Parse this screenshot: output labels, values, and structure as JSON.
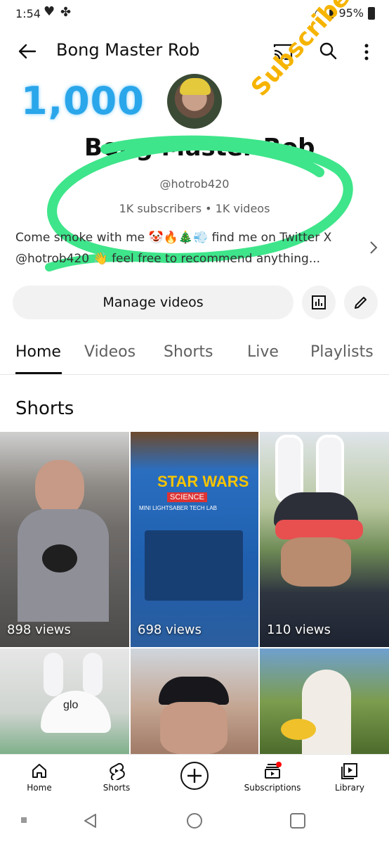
{
  "status_bar": {
    "time": "1:54",
    "battery": "95%"
  },
  "header": {
    "title": "Bong Master Rob"
  },
  "overlays": {
    "count": "1,000",
    "label": "Subscribers"
  },
  "channel": {
    "name": "Bong Master Rob",
    "handle": "@hotrob420",
    "stats": "1K subscribers • 1K videos",
    "description": "Come smoke with me 🤡🔥🎄💨 find me on Twitter X @hotrob420 👋 feel free to recommend anything..."
  },
  "actions": {
    "manage_label": "Manage videos"
  },
  "tabs": [
    "Home",
    "Videos",
    "Shorts",
    "Live",
    "Playlists"
  ],
  "section": {
    "title": "Shorts"
  },
  "shorts": [
    {
      "views": "898 views"
    },
    {
      "views": "698 views"
    },
    {
      "views": "110 views"
    },
    {
      "views": ""
    },
    {
      "views": ""
    },
    {
      "views": ""
    }
  ],
  "thumb_text": {
    "t2_title": "STAR WARS",
    "t2_sub": "SCIENCE",
    "t2_caption": "MINI LIGHTSABER TECH LAB",
    "t4_hat": "glo"
  },
  "bottom_nav": {
    "home": "Home",
    "shorts": "Shorts",
    "subscriptions": "Subscriptions",
    "library": "Library"
  },
  "colors": {
    "overlay_blue": "#2aa6ea",
    "overlay_gold": "#f6b400",
    "scribble_green": "#3ee58a",
    "notification_red": "#ff0000"
  }
}
